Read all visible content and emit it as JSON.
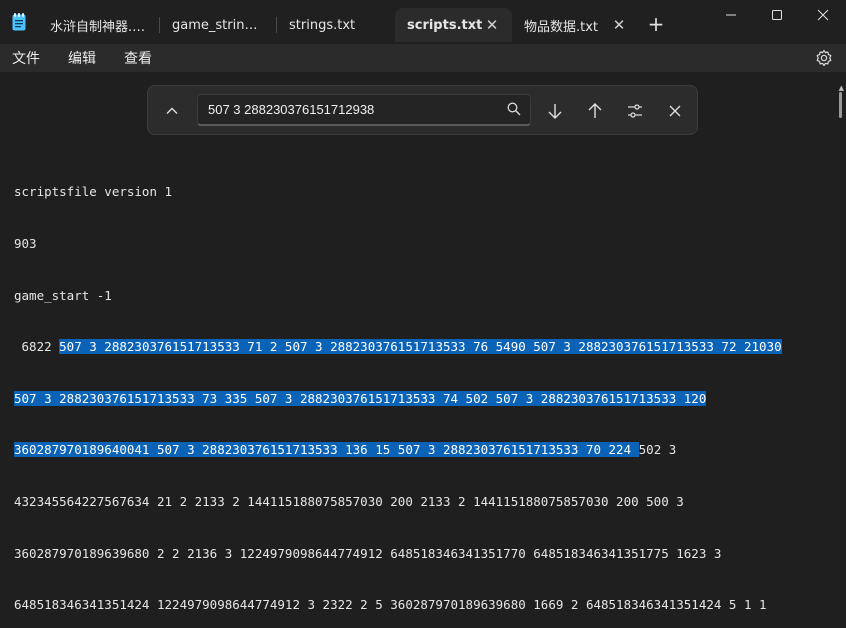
{
  "tabs": [
    {
      "label": "水浒自制神器.txt",
      "active": false
    },
    {
      "label": "game_strings.csv",
      "active": false
    },
    {
      "label": "strings.txt",
      "active": false
    },
    {
      "label": "scripts.txt",
      "active": true
    },
    {
      "label": "物品数据.txt",
      "active": false
    }
  ],
  "tab_close_glyph": "✕",
  "new_tab_glyph": "+",
  "menu": {
    "file": "文件",
    "edit": "编辑",
    "view": "查看"
  },
  "find": {
    "query": "507 3 288230376151712938"
  },
  "content": {
    "line1": "scriptsfile version 1",
    "line2": "903",
    "line3": "game_start -1",
    "line4_pre": " 6822 ",
    "line4_hl": "507 3 288230376151713533 71 2 507 3 288230376151713533 76 5490 507 3 288230376151713533 72 21030",
    "line5_hl": "507 3 288230376151713533 73 335 507 3 288230376151713533 74 502 507 3 288230376151713533 120",
    "line6_hl": "360287970189640041 507 3 288230376151713533 136 15 507 3 288230376151713533 70 224 ",
    "line6_post": "502 3",
    "line7": "432345564227567634 21 2 2133 2 144115188075857030 200 2133 2 144115188075857030 200 500 3",
    "line8": "360287970189639680 2 2 2136 3 1224979098644774912 648518346341351770 648518346341351775 1623 3",
    "line9": "648518346341351424 1224979098644774912 3 2322 2 5 360287970189639680 1669 2 648518346341351424 5 1 1"
  },
  "colors": {
    "background": "#1f1f1f",
    "selection": "#0b63b8",
    "text": "#e6e6e6"
  }
}
